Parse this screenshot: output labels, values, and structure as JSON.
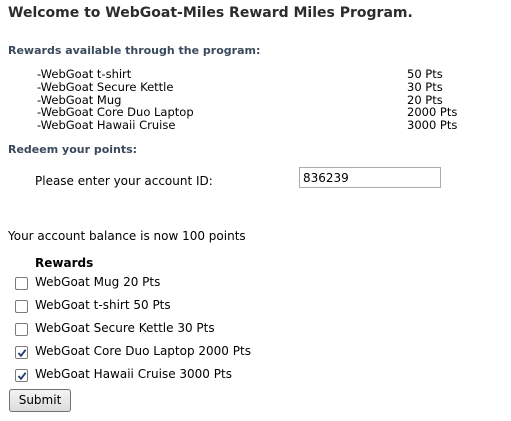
{
  "page": {
    "title": "Welcome to WebGoat-Miles Reward Miles Program.",
    "rewards_section_label": "Rewards available through the program:",
    "rewards_list": [
      {
        "name": "-WebGoat t-shirt",
        "points": "50 Pts"
      },
      {
        "name": "-WebGoat Secure Kettle",
        "points": "30 Pts"
      },
      {
        "name": "-WebGoat Mug",
        "points": "20 Pts"
      },
      {
        "name": "-WebGoat Core Duo Laptop",
        "points": "2000 Pts"
      },
      {
        "name": "-WebGoat Hawaii Cruise",
        "points": "3000 Pts"
      }
    ],
    "redeem_section_label": "Redeem your points:",
    "account_id_label": "Please enter your account ID:",
    "account_id_value": "836239",
    "balance_message": "Your account balance is now 100 points",
    "rewards_header": "Rewards",
    "reward_options": [
      {
        "label": "WebGoat Mug 20 Pts",
        "checked": false
      },
      {
        "label": "WebGoat t-shirt 50 Pts",
        "checked": false
      },
      {
        "label": "WebGoat Secure Kettle 30 Pts",
        "checked": false
      },
      {
        "label": "WebGoat Core Duo Laptop 2000 Pts",
        "checked": true
      },
      {
        "label": "WebGoat Hawaii Cruise 3000 Pts",
        "checked": true
      }
    ],
    "submit_label": "Submit"
  },
  "colors": {
    "section_label": "#3a4a5c",
    "checkmark": "#1f3b6e"
  }
}
